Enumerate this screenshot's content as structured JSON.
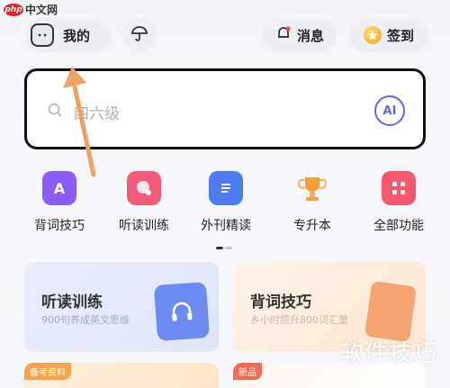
{
  "watermark": {
    "logo": "php",
    "site": "中文网",
    "bottom_right": "软件技巧"
  },
  "header": {
    "me_label": "我的",
    "messages_label": "消息",
    "signin_label": "签到"
  },
  "search": {
    "placeholder": "四六级",
    "ai_label": "AI"
  },
  "quick_actions": [
    {
      "label": "背词技巧",
      "icon": "letter-a-icon",
      "color": "#8b5cf6",
      "glyph": "A"
    },
    {
      "label": "听读训练",
      "icon": "listening-head-icon",
      "color": "#f25a7a",
      "glyph": ""
    },
    {
      "label": "外刊精读",
      "icon": "document-list-icon",
      "color": "#4c7df0",
      "glyph": ""
    },
    {
      "label": "专升本",
      "icon": "trophy-icon",
      "color": "#f59e3c",
      "glyph": ""
    },
    {
      "label": "全部功能",
      "icon": "grid-apps-icon",
      "color": "#f4596b",
      "glyph": ""
    }
  ],
  "cards": [
    {
      "title": "听读训练",
      "subtitle": "900句养成英文思维"
    },
    {
      "title": "背词技巧",
      "subtitle": "乡小时提升800词汇量"
    }
  ],
  "bottom_tags": {
    "left": "备考资料",
    "right": "新品"
  }
}
